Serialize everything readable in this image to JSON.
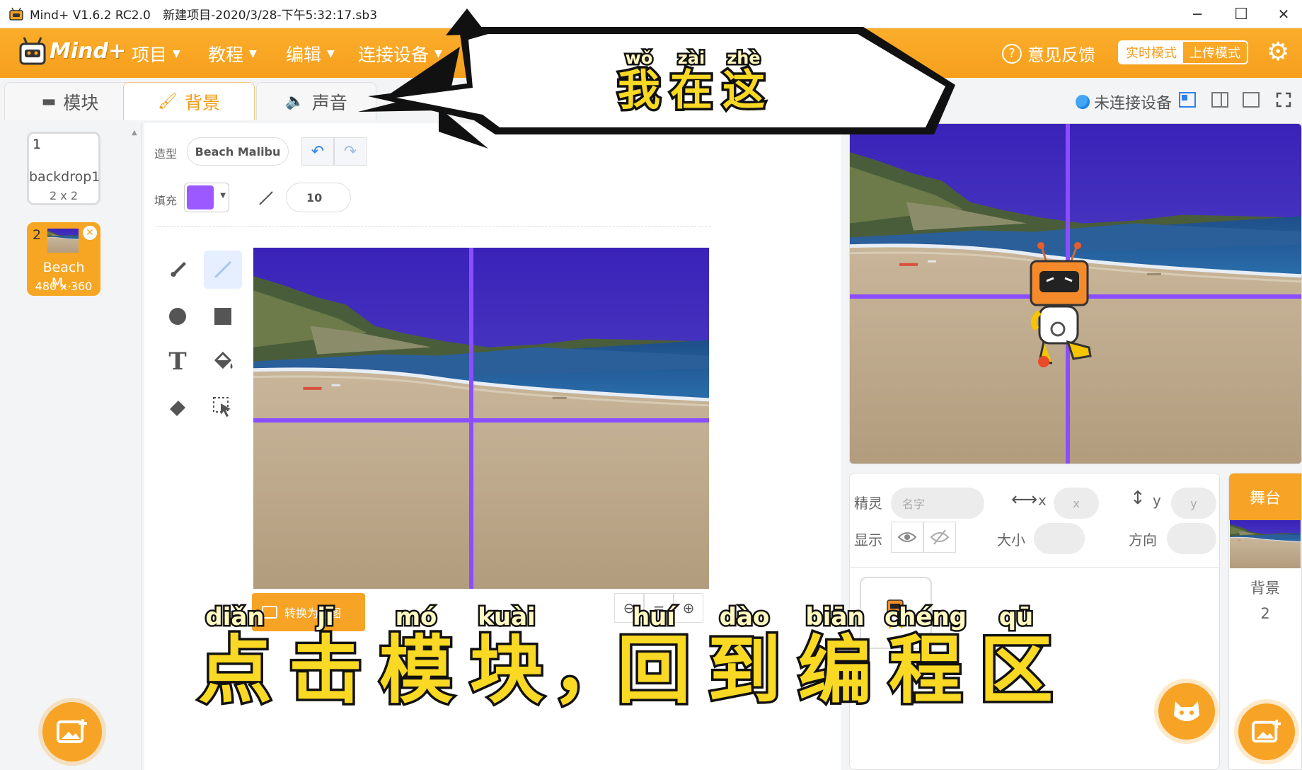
{
  "titlebar": {
    "app_name": "Mind+ V1.6.2 RC2.0",
    "project": "新建项目-2020/3/28-下午5:32:17.sb3",
    "minimize": "─",
    "maximize": "☐",
    "close": "✕"
  },
  "menubar": {
    "logo_text": "Mind+",
    "items": [
      {
        "label": "项目"
      },
      {
        "label": "教程"
      },
      {
        "label": "编辑"
      },
      {
        "label": "连接设备"
      }
    ],
    "feedback_label": "意见反馈",
    "mode_live": "实时模式",
    "mode_upload": "上传模式",
    "settings_icon": "gear-icon"
  },
  "tabs": {
    "blocks": "模块",
    "background": "背景",
    "sound": "声音"
  },
  "device": {
    "status": "未连接设备"
  },
  "backdrops": [
    {
      "number": "1",
      "name": "backdrop1",
      "size": "2 x 2"
    },
    {
      "number": "2",
      "name": "Beach M...",
      "size": "480 x 360"
    }
  ],
  "editor": {
    "costume_label": "造型",
    "costume_name": "Beach Malibu",
    "fill_label": "填充",
    "fill_color": "#9b59ff",
    "outline_width": "10",
    "convert_button": "转换为位图"
  },
  "colors": {
    "accent": "#f7a325",
    "line_color": "#8a4dff"
  },
  "sprite_info": {
    "sprite_label": "精灵",
    "name_placeholder": "名字",
    "x_label": "x",
    "x_placeholder": "x",
    "y_label": "y",
    "y_placeholder": "y",
    "show_label": "显示",
    "size_label": "大小",
    "direction_label": "方向"
  },
  "stage_panel": {
    "title": "舞台",
    "backdrop_label": "背景",
    "backdrop_count": "2"
  },
  "caption_bubble": [
    {
      "pinyin": "wǒ",
      "hanzi": "我"
    },
    {
      "pinyin": "zài",
      "hanzi": "在"
    },
    {
      "pinyin": "zhè",
      "hanzi": "这"
    }
  ],
  "caption_subtitle": [
    {
      "pinyin": "diǎn",
      "hanzi": "点"
    },
    {
      "pinyin": "jī",
      "hanzi": "击"
    },
    {
      "pinyin": "mó",
      "hanzi": "模"
    },
    {
      "pinyin": "kuài",
      "hanzi": "块"
    },
    {
      "pinyin": "",
      "hanzi": "，"
    },
    {
      "pinyin": "huí",
      "hanzi": "回"
    },
    {
      "pinyin": "dào",
      "hanzi": "到"
    },
    {
      "pinyin": "biān",
      "hanzi": "编"
    },
    {
      "pinyin": "chéng",
      "hanzi": "程"
    },
    {
      "pinyin": "qū",
      "hanzi": "区"
    }
  ]
}
